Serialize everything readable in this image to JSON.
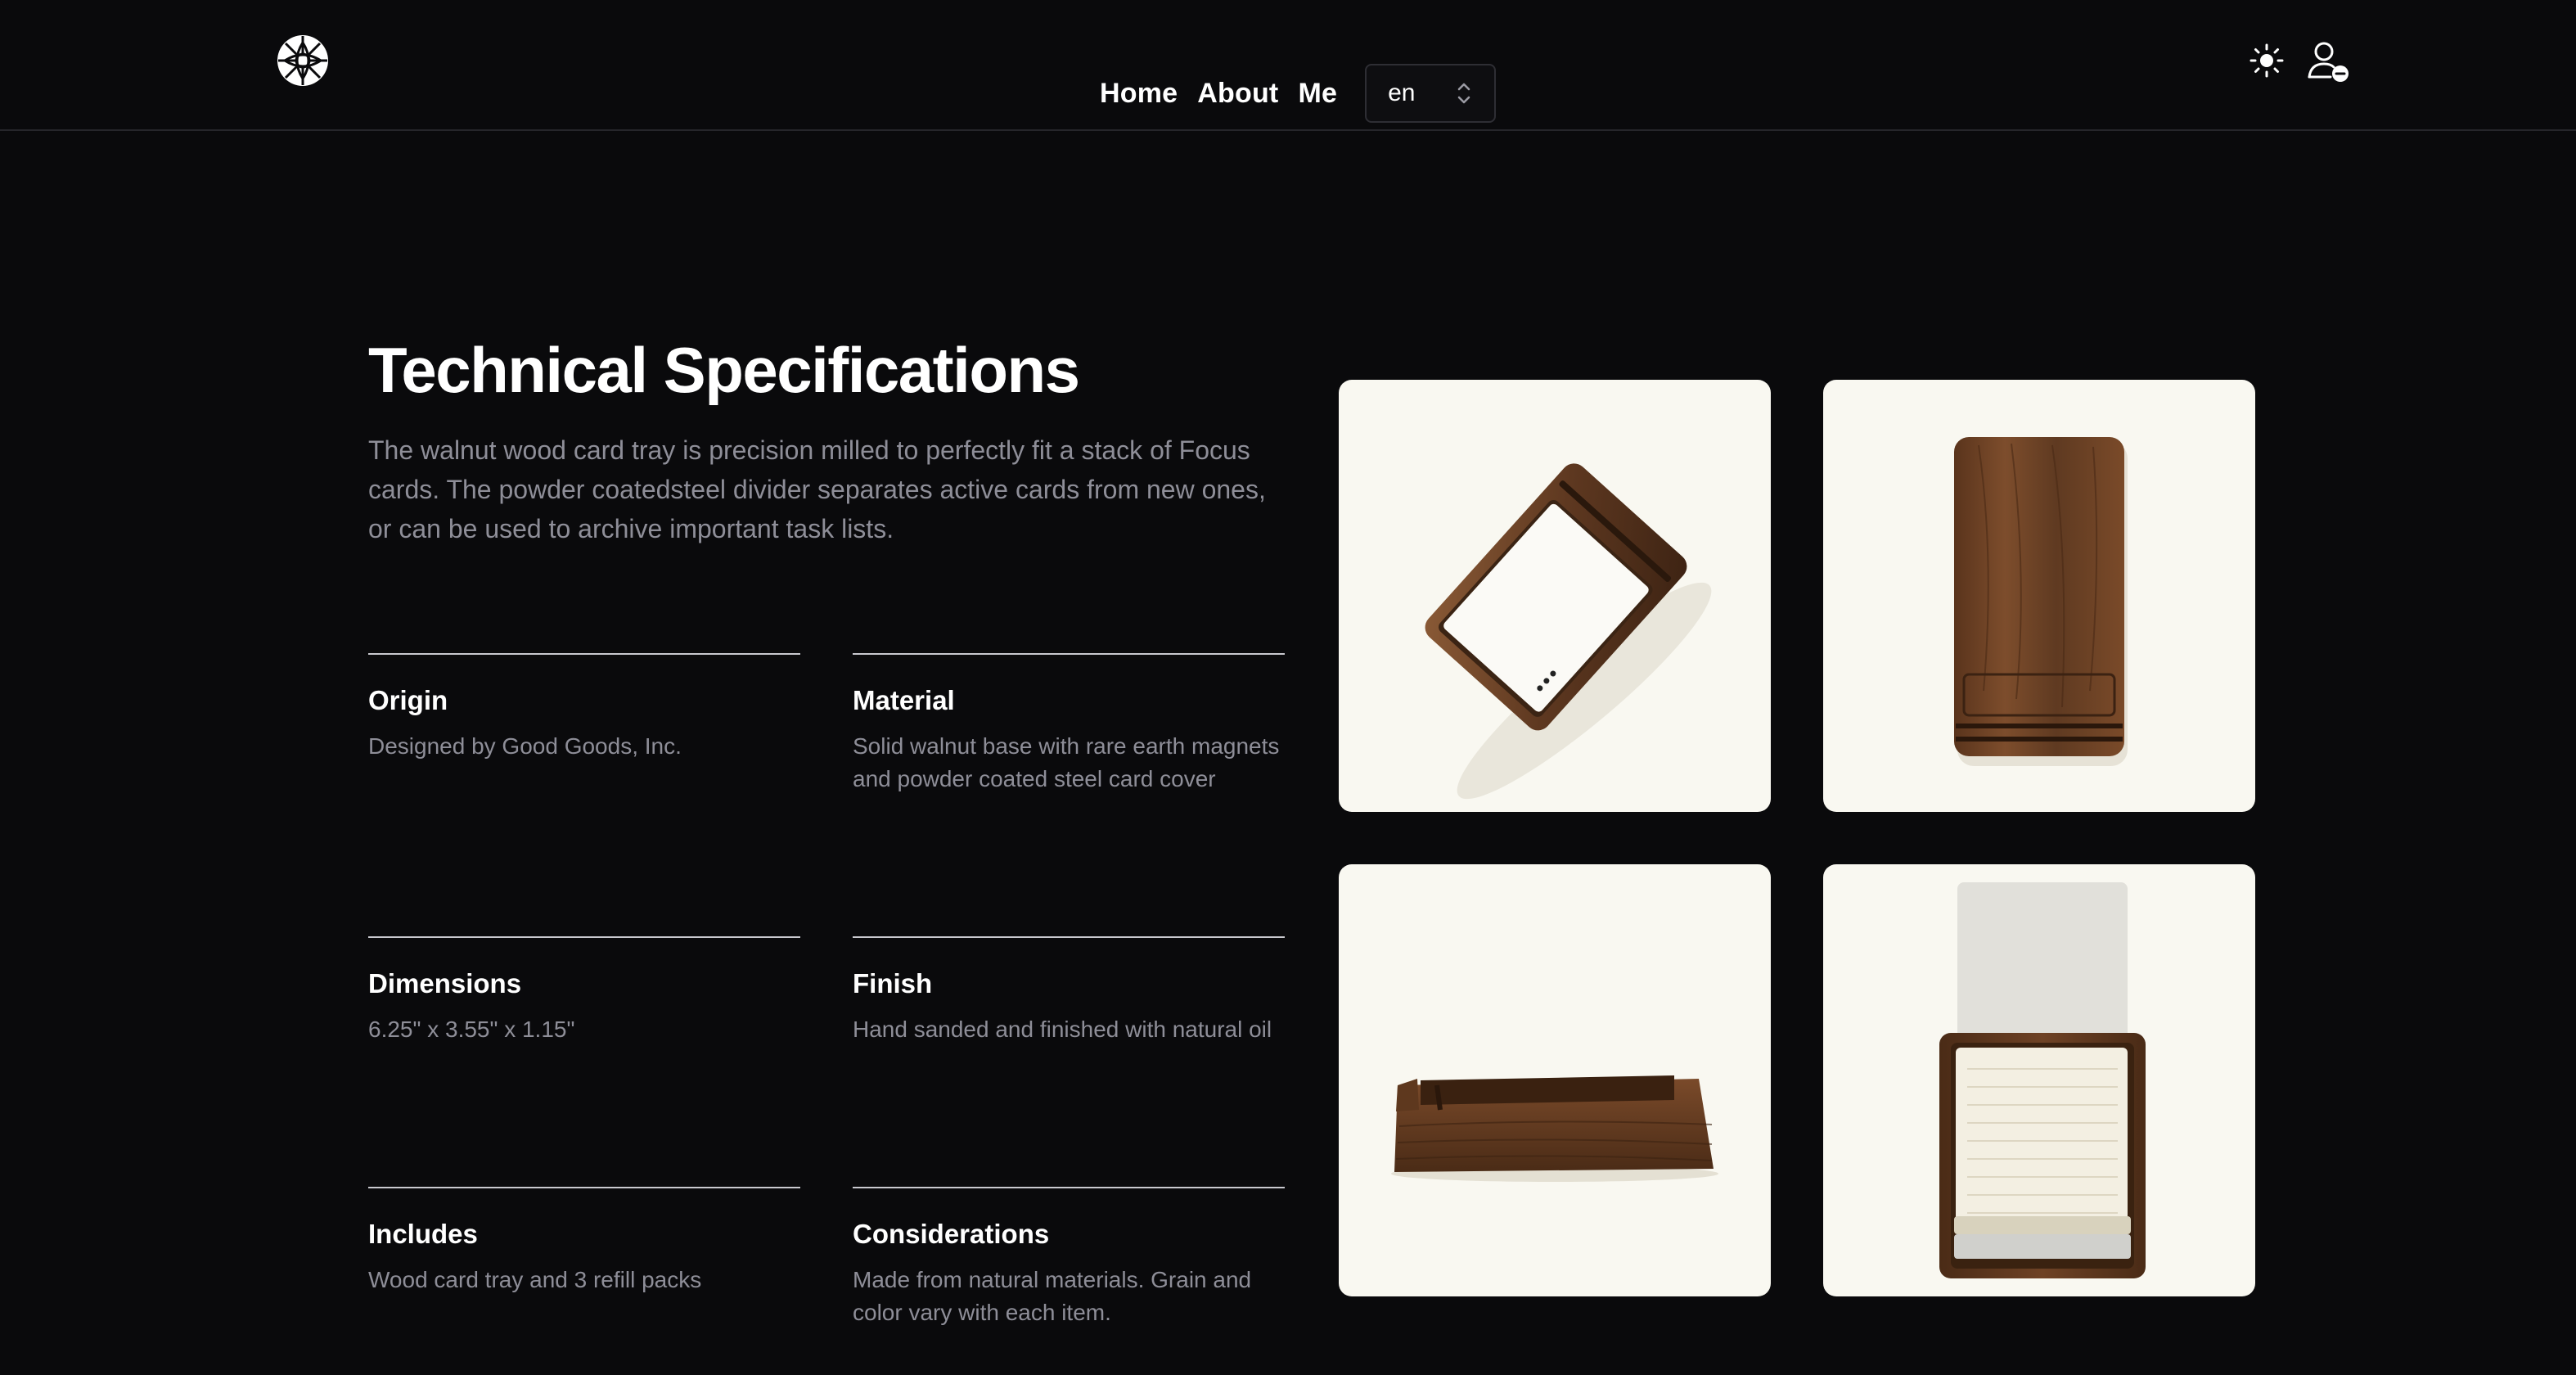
{
  "header": {
    "logo_icon": "globe-logo-icon",
    "nav": [
      {
        "label": "Home"
      },
      {
        "label": "About"
      },
      {
        "label": "Me"
      }
    ],
    "language": {
      "selected": "en",
      "icon": "chevron-up-down-icon"
    },
    "theme_icon": "sun-icon",
    "user_icon": "user-minus-icon"
  },
  "main": {
    "title": "Technical Specifications",
    "intro": "The walnut wood card tray is precision milled to perfectly fit a stack of Focus cards. The powder coatedsteel divider separates active cards from new ones, or can be used to archive important task lists.",
    "specs": [
      {
        "label": "Origin",
        "value": "Designed by Good Goods, Inc."
      },
      {
        "label": "Material",
        "value": "Solid walnut base with rare earth magnets and powder coated steel card cover"
      },
      {
        "label": "Dimensions",
        "value": "6.25\" x 3.55\" x 1.15\""
      },
      {
        "label": "Finish",
        "value": "Hand sanded and finished with natural oil"
      },
      {
        "label": "Includes",
        "value": "Wood card tray and 3 refill packs"
      },
      {
        "label": "Considerations",
        "value": "Made from natural materials. Grain and color vary with each item."
      }
    ],
    "photos": [
      {
        "subject": "walnut card tray with white card, angled top view"
      },
      {
        "subject": "walnut card tray, top-down view"
      },
      {
        "subject": "walnut card tray, side view"
      },
      {
        "subject": "walnut card tray with refill cards, front view"
      }
    ]
  },
  "colors": {
    "background": "#0a0a0c",
    "text": "#ffffff",
    "muted_text": "#8e8e98",
    "divider": "#c9c9cf",
    "photo_background": "#f9f8f1",
    "walnut": "#6b4226"
  }
}
